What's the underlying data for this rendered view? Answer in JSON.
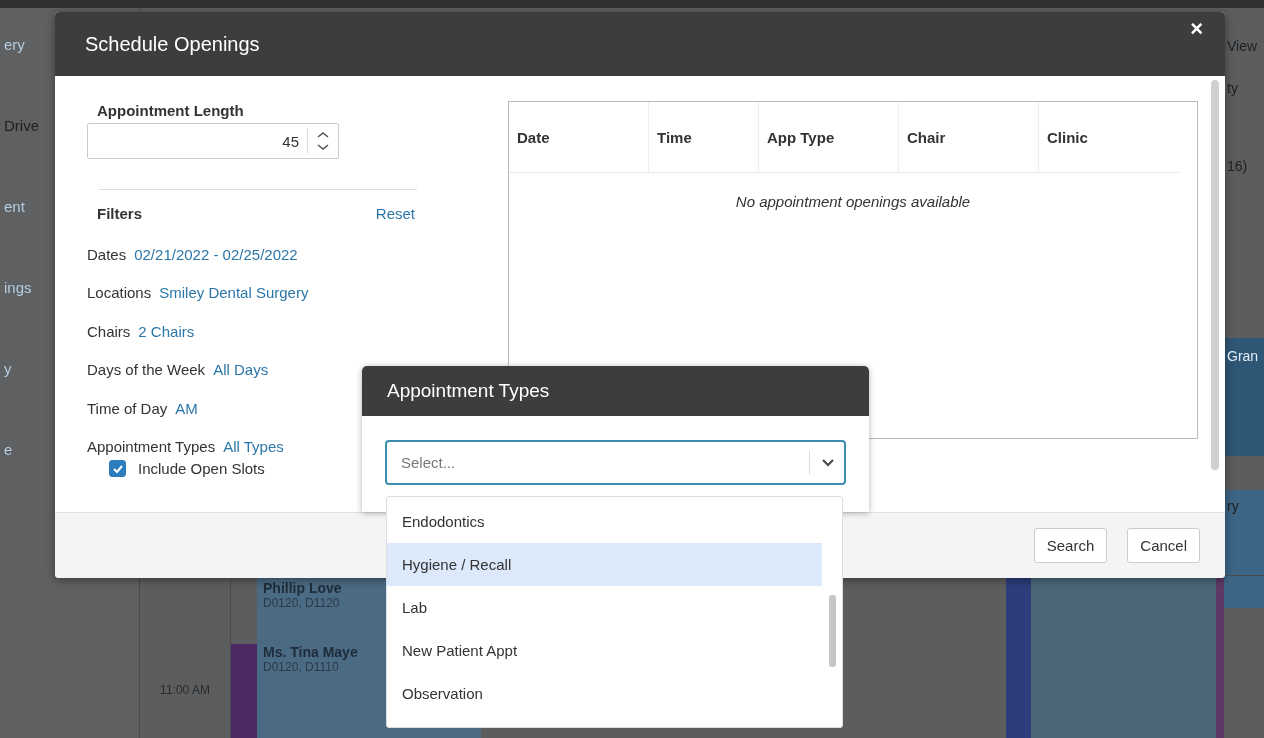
{
  "background": {
    "sidebar_items": [
      "ery",
      "Drive",
      "ent",
      "ings",
      "y",
      "e"
    ],
    "right_items": [
      "View",
      "ty",
      "16)",
      "Gran",
      "ry"
    ],
    "time_label": "11:00 AM",
    "appointments": [
      {
        "name": "Phillip Love",
        "codes": "D0120, D1120"
      },
      {
        "name": "Ms. Tina Maye",
        "codes": "D0120, D1110"
      }
    ]
  },
  "dialog": {
    "title": "Schedule Openings",
    "close": "×",
    "length_label": "Appointment Length",
    "length_value": "45",
    "filters_title": "Filters",
    "reset": "Reset",
    "filters": [
      {
        "label": "Dates",
        "value": "02/21/2022 - 02/25/2022"
      },
      {
        "label": "Locations",
        "value": "Smiley Dental Surgery"
      },
      {
        "label": "Chairs",
        "value": "2 Chairs"
      },
      {
        "label": "Days of the Week",
        "value": "All Days"
      },
      {
        "label": "Time of Day",
        "value": "AM"
      },
      {
        "label": "Appointment Types",
        "value": "All Types"
      }
    ],
    "include_open_slots": {
      "label": "Include Open Slots",
      "checked": true
    },
    "table": {
      "columns": [
        "Date",
        "Time",
        "App Type",
        "Chair",
        "Clinic"
      ],
      "empty_message": "No appointment openings available"
    },
    "buttons": [
      "Search",
      "Cancel"
    ]
  },
  "popover": {
    "title": "Appointment Types",
    "select": {
      "placeholder": "Select..."
    },
    "options": [
      {
        "label": "Endodontics",
        "selected": false
      },
      {
        "label": "Hygiene / Recall",
        "selected": true
      },
      {
        "label": "Lab",
        "selected": false
      },
      {
        "label": "New Patient Appt",
        "selected": false
      },
      {
        "label": "Observation",
        "selected": false
      }
    ]
  }
}
